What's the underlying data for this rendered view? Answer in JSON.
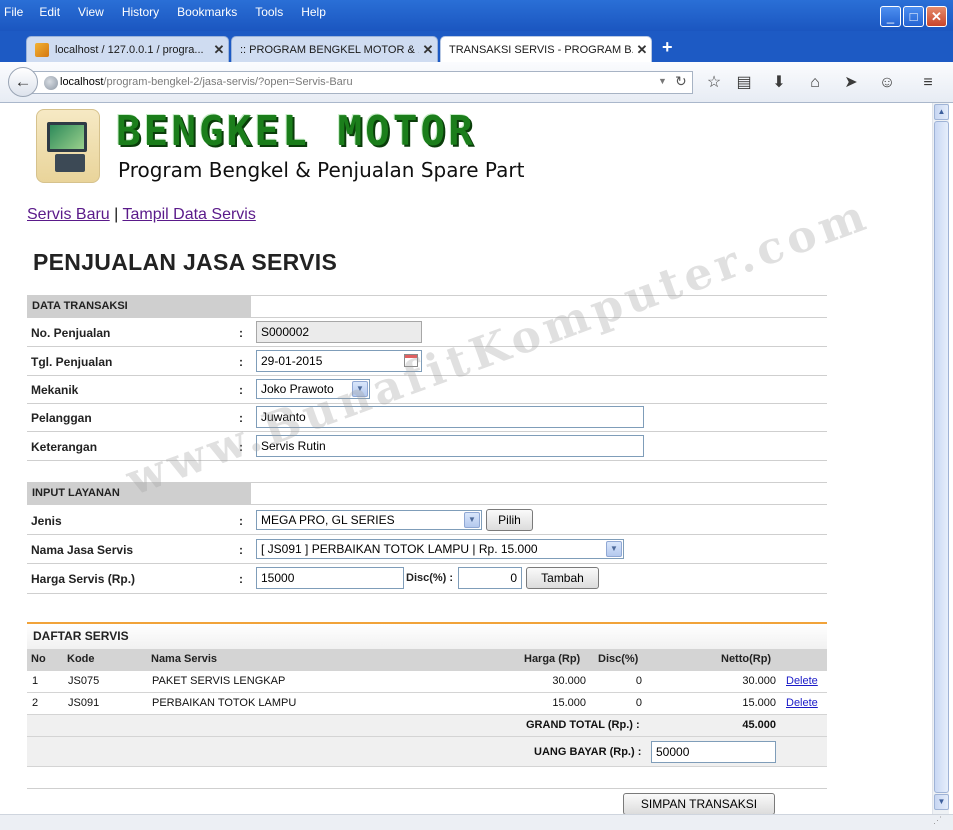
{
  "browser": {
    "menu": [
      "File",
      "Edit",
      "View",
      "History",
      "Bookmarks",
      "Tools",
      "Help"
    ],
    "tabs": [
      {
        "label": "localhost / 127.0.0.1 / progra..."
      },
      {
        "label": ":: PROGRAM BENGKEL MOTOR & ..."
      },
      {
        "label": "TRANSAKSI SERVIS - PROGRAM B..."
      }
    ],
    "url_host": "localhost",
    "url_path": "/program-bengkel-2/jasa-servis/?open=Servis-Baru"
  },
  "header": {
    "brand_title": "BENGKEL MOTOR",
    "brand_subtitle": "Program Bengkel & Penjualan Spare Part"
  },
  "nav": {
    "link_servis_baru": "Servis Baru",
    "separator": "|",
    "link_tampil": "Tampil Data Servis"
  },
  "page_title": "PENJUALAN JASA SERVIS",
  "data_transaksi": {
    "section_label": "DATA TRANSAKSI",
    "no_penjualan_label": "No. Penjualan",
    "no_penjualan_value": "S000002",
    "tgl_penjualan_label": "Tgl. Penjualan",
    "tgl_penjualan_value": "29-01-2015",
    "mekanik_label": "Mekanik",
    "mekanik_value": "Joko Prawoto",
    "pelanggan_label": "Pelanggan",
    "pelanggan_value": "Juwanto",
    "keterangan_label": "Keterangan",
    "keterangan_value": "Servis Rutin",
    "colon": ":"
  },
  "input_layanan": {
    "section_label": "INPUT LAYANAN",
    "jenis_label": "Jenis",
    "jenis_value": "MEGA PRO, GL SERIES",
    "pilih_button": "Pilih",
    "nama_jasa_label": "Nama Jasa Servis",
    "nama_jasa_value": "[ JS091 ] PERBAIKAN TOTOK LAMPU | Rp. 15.000",
    "harga_label": "Harga Servis (Rp.)",
    "harga_value": "15000",
    "disc_label": "Disc(%) :",
    "disc_value": "0",
    "tambah_button": "Tambah"
  },
  "daftar_servis": {
    "title": "DAFTAR SERVIS",
    "columns": {
      "no": "No",
      "kode": "Kode",
      "nama": "Nama Servis",
      "harga": "Harga (Rp)",
      "disc": "Disc(%)",
      "netto": "Netto(Rp)"
    },
    "rows": [
      {
        "no": "1",
        "kode": "JS075",
        "nama": "PAKET SERVIS LENGKAP",
        "harga": "30.000",
        "disc": "0",
        "netto": "30.000",
        "action": "Delete"
      },
      {
        "no": "2",
        "kode": "JS091",
        "nama": "PERBAIKAN TOTOK LAMPU",
        "harga": "15.000",
        "disc": "0",
        "netto": "15.000",
        "action": "Delete"
      }
    ],
    "grand_total_label": "GRAND TOTAL (Rp.) :",
    "grand_total_value": "45.000",
    "uang_bayar_label": "UANG BAYAR (Rp.) :",
    "uang_bayar_value": "50000",
    "simpan_button": "SIMPAN TRANSAKSI"
  },
  "watermark": "www.BunafitKomputer.com",
  "colors": {
    "brand_green": "#1b7e1b",
    "accent_orange": "#f1a33a",
    "link_purple": "#5a1a8a",
    "link_blue": "#1a1ac8"
  }
}
